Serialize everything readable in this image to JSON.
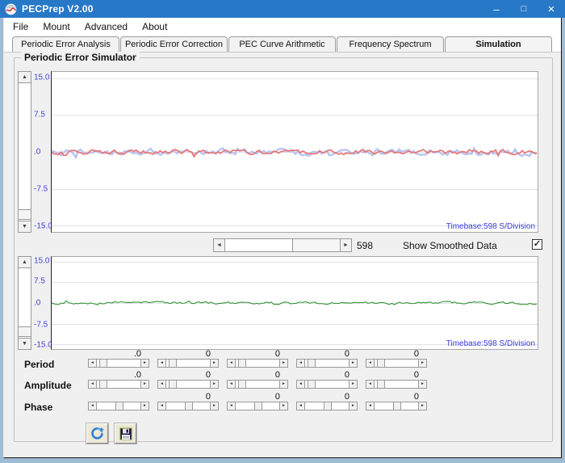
{
  "window": {
    "title": "PECPrep V2.00",
    "controls": {
      "minimize": "minimize",
      "maximize": "maximize",
      "close": "close"
    }
  },
  "icons": {
    "minimize": "–",
    "maximize": "□",
    "close": "×",
    "arrow_up": "▲",
    "arrow_down": "▼",
    "arrow_left": "◄",
    "arrow_right": "►",
    "check": "✓"
  },
  "menu": {
    "items": [
      "File",
      "Mount",
      "Advanced",
      "About"
    ]
  },
  "tabs": {
    "items": [
      {
        "label": "Periodic Error Analysis",
        "active": false
      },
      {
        "label": "Periodic Error Correction",
        "active": false
      },
      {
        "label": "PEC Curve Arithmetic",
        "active": false
      },
      {
        "label": "Frequency Spectrum",
        "active": false
      },
      {
        "label": "Simulation",
        "active": true
      }
    ]
  },
  "simulator": {
    "title": "Periodic Error Simulator",
    "y_ticks": [
      "15.0",
      "7.5",
      ".0",
      "-7.5",
      "-15.0"
    ],
    "charts": [
      {
        "name": "raw-error-chart",
        "line_color": "#e87474",
        "secondary_color": "#b9c4ee",
        "timebase": "Timebase:598 S/Division"
      },
      {
        "name": "smoothed-error-chart",
        "line_color": "#1f8a1f",
        "timebase": "Timebase:598 S/Division"
      }
    ],
    "scroll_value": "598",
    "show_smoothed_label": "Show Smoothed Data",
    "show_smoothed_checked": true
  },
  "sliders": {
    "rows": [
      {
        "label": "Period",
        "values": [
          ".0",
          "0",
          "0",
          "0",
          "0"
        ],
        "thumb_position": 0.08
      },
      {
        "label": "Amplitude",
        "values": [
          ".0",
          "0",
          "0",
          "0",
          "0"
        ],
        "thumb_position": 0.08
      },
      {
        "label": "Phase",
        "values": [
          "",
          "0",
          "0",
          "0",
          "0"
        ],
        "thumb_position": 0.42
      }
    ]
  },
  "actions": {
    "refresh": "refresh",
    "save": "save"
  },
  "colors": {
    "titlebar": "#2779c8",
    "frame": "#9fbcd5",
    "axis_label": "#4444d8",
    "timebase_text": "#3a3ae0"
  }
}
